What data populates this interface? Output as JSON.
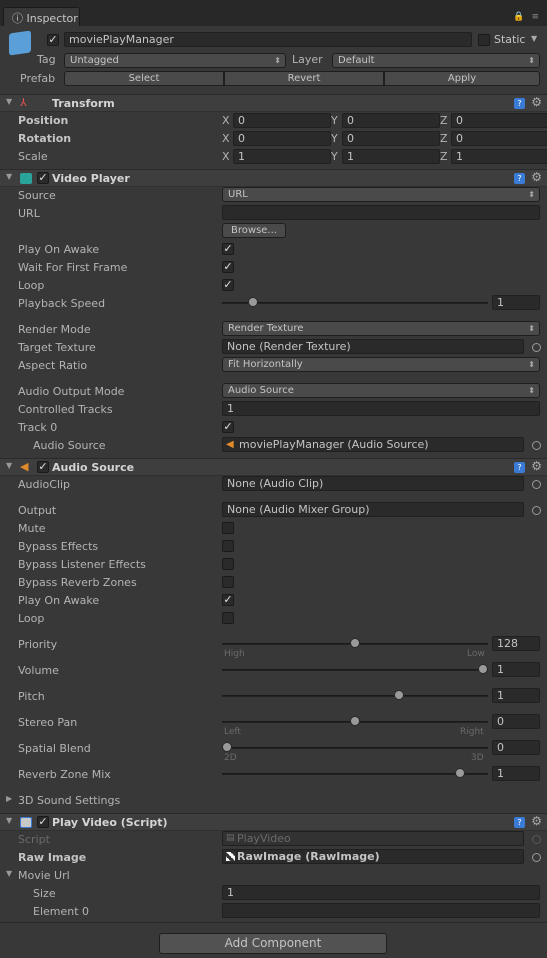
{
  "window": {
    "tab_title": "Inspector"
  },
  "go": {
    "name": "moviePlayManager",
    "static_label": "Static",
    "tag_label": "Tag",
    "tag_value": "Untagged",
    "layer_label": "Layer",
    "layer_value": "Default",
    "prefab_label": "Prefab",
    "select": "Select",
    "revert": "Revert",
    "apply": "Apply"
  },
  "transform": {
    "title": "Transform",
    "position": "Position",
    "rotation": "Rotation",
    "scale": "Scale",
    "pos": [
      "0",
      "0",
      "0"
    ],
    "rot": [
      "0",
      "0",
      "0"
    ],
    "scl": [
      "1",
      "1",
      "1"
    ],
    "axes": [
      "X",
      "Y",
      "Z"
    ]
  },
  "video": {
    "title": "Video Player",
    "source": "Source",
    "source_value": "URL",
    "url": "URL",
    "url_value": "",
    "browse": "Browse...",
    "play_on_awake": "Play On Awake",
    "wait_first": "Wait For First Frame",
    "loop": "Loop",
    "playback_speed": "Playback Speed",
    "playback_speed_value": "1",
    "render_mode": "Render Mode",
    "render_mode_value": "Render Texture",
    "target_texture": "Target Texture",
    "target_texture_value": "None (Render Texture)",
    "aspect": "Aspect Ratio",
    "aspect_value": "Fit Horizontally",
    "audio_output": "Audio Output Mode",
    "audio_output_value": "Audio Source",
    "controlled_tracks": "Controlled Tracks",
    "controlled_tracks_value": "1",
    "track0": "Track 0",
    "audio_source": "Audio Source",
    "audio_source_value": "moviePlayManager (Audio Source)",
    "playback_speed_level": 0.1
  },
  "audio": {
    "title": "Audio Source",
    "clip": "AudioClip",
    "clip_value": "None (Audio Clip)",
    "output": "Output",
    "output_value": "None (Audio Mixer Group)",
    "mute": "Mute",
    "bypass_effects": "Bypass Effects",
    "bypass_listener": "Bypass Listener Effects",
    "bypass_reverb": "Bypass Reverb Zones",
    "play_on_awake": "Play On Awake",
    "loop": "Loop",
    "priority": "Priority",
    "priority_value": "128",
    "high": "High",
    "low": "Low",
    "volume": "Volume",
    "volume_value": "1",
    "pitch": "Pitch",
    "pitch_value": "1",
    "stereo_pan": "Stereo Pan",
    "stereo_pan_value": "0",
    "left": "Left",
    "right": "Right",
    "spatial_blend": "Spatial Blend",
    "spatial_blend_value": "0",
    "d2": "2D",
    "d3": "3D",
    "reverb_mix": "Reverb Zone Mix",
    "reverb_mix_value": "1",
    "sound3d": "3D Sound Settings",
    "priority_level": 0.5,
    "volume_level": 1.0,
    "pitch_level": 0.67,
    "pan_level": 0.5,
    "spatial_level": 0.0,
    "reverb_level": 0.91
  },
  "script": {
    "title": "Play Video (Script)",
    "script_label": "Script",
    "script_value": "PlayVideo",
    "raw_image": "Raw Image",
    "raw_image_value": "RawImage (RawImage)",
    "movie_url": "Movie Url",
    "size": "Size",
    "size_value": "1",
    "element0": "Element 0",
    "element0_value": ""
  },
  "add_component": "Add Component"
}
